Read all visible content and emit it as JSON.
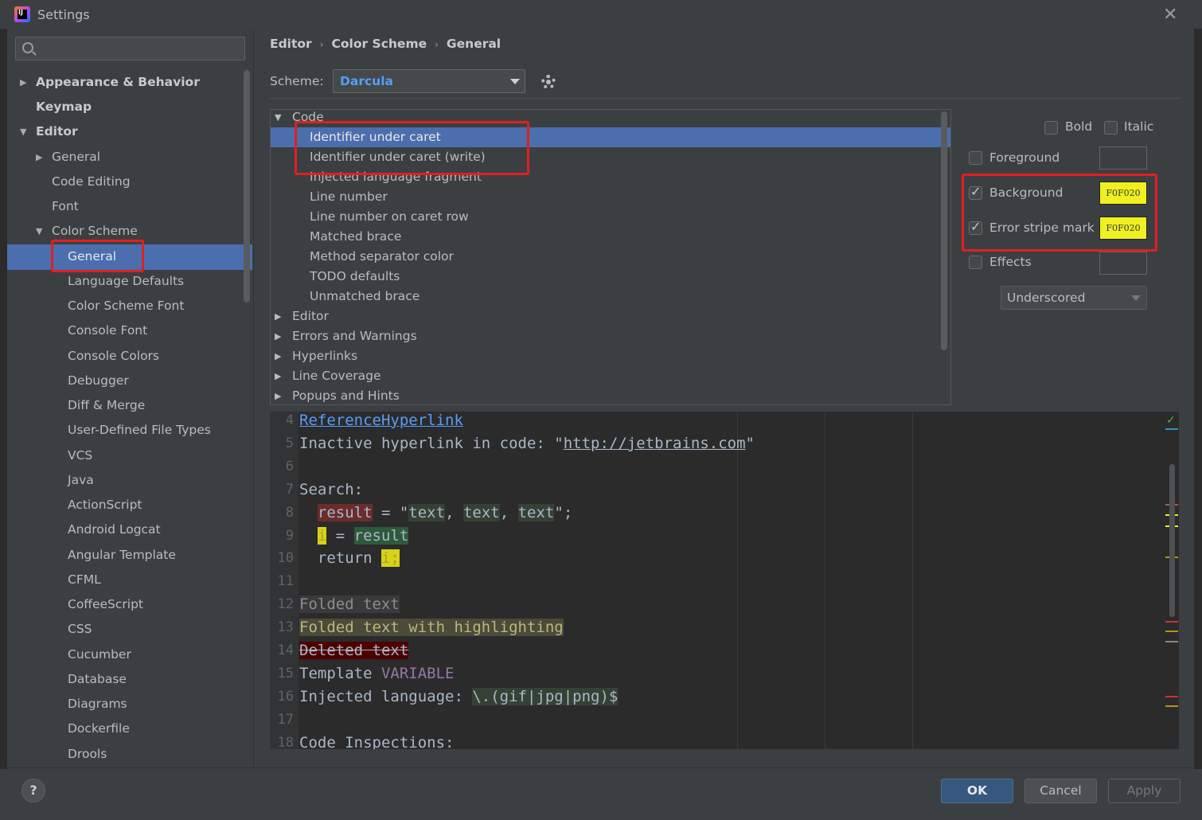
{
  "window": {
    "title": "Settings",
    "app_icon_text": "IJ"
  },
  "search": {
    "placeholder": ""
  },
  "tree": {
    "items": [
      {
        "label": "Appearance & Behavior"
      },
      {
        "label": "Keymap"
      },
      {
        "label": "Editor"
      },
      {
        "label": "General"
      },
      {
        "label": "Code Editing"
      },
      {
        "label": "Font"
      },
      {
        "label": "Color Scheme"
      },
      {
        "label": "General"
      },
      {
        "label": "Language Defaults"
      },
      {
        "label": "Color Scheme Font"
      },
      {
        "label": "Console Font"
      },
      {
        "label": "Console Colors"
      },
      {
        "label": "Debugger"
      },
      {
        "label": "Diff & Merge"
      },
      {
        "label": "User-Defined File Types"
      },
      {
        "label": "VCS"
      },
      {
        "label": "Java"
      },
      {
        "label": "ActionScript"
      },
      {
        "label": "Android Logcat"
      },
      {
        "label": "Angular Template"
      },
      {
        "label": "CFML"
      },
      {
        "label": "CoffeeScript"
      },
      {
        "label": "CSS"
      },
      {
        "label": "Cucumber"
      },
      {
        "label": "Database"
      },
      {
        "label": "Diagrams"
      },
      {
        "label": "Dockerfile"
      },
      {
        "label": "Drools"
      }
    ]
  },
  "breadcrumb": {
    "part1": "Editor",
    "part2": "Color Scheme",
    "part3": "General",
    "sep": "›"
  },
  "scheme": {
    "label": "Scheme:",
    "value": "Darcula"
  },
  "codelist": {
    "rows": [
      {
        "label": "Code"
      },
      {
        "label": "Identifier under caret"
      },
      {
        "label": "Identifier under caret (write)"
      },
      {
        "label": "Injected language fragment"
      },
      {
        "label": "Line number"
      },
      {
        "label": "Line number on caret row"
      },
      {
        "label": "Matched brace"
      },
      {
        "label": "Method separator color"
      },
      {
        "label": "TODO defaults"
      },
      {
        "label": "Unmatched brace"
      },
      {
        "label": "Editor"
      },
      {
        "label": "Errors and Warnings"
      },
      {
        "label": "Hyperlinks"
      },
      {
        "label": "Line Coverage"
      },
      {
        "label": "Popups and Hints"
      }
    ]
  },
  "props": {
    "bold": "Bold",
    "italic": "Italic",
    "foreground": "Foreground",
    "background": "Background",
    "background_color": "F0F020",
    "error_stripe": "Error stripe mark",
    "error_stripe_color": "F0F020",
    "effects": "Effects",
    "effects_type": "Underscored"
  },
  "editor": {
    "lines": [
      {
        "n": "4",
        "parts": [
          [
            "hl-link",
            "ReferenceHyperlink"
          ]
        ]
      },
      {
        "n": "5",
        "parts": [
          [
            "",
            "Inactive hyperlink in code: \""
          ],
          [
            "u",
            "http://jetbrains.com"
          ],
          [
            "",
            "\""
          ]
        ]
      },
      {
        "n": "6",
        "parts": []
      },
      {
        "n": "7",
        "parts": [
          [
            "",
            "Search:"
          ]
        ]
      },
      {
        "n": "8",
        "parts": [
          [
            "",
            "  "
          ],
          [
            "err-bg",
            "result"
          ],
          [
            "",
            " = \""
          ],
          [
            "grn-bg",
            "text"
          ],
          [
            "",
            ", "
          ],
          [
            "grn-bg",
            "text"
          ],
          [
            "",
            ", "
          ],
          [
            "grn-bg",
            "text"
          ],
          [
            "",
            "\";"
          ]
        ]
      },
      {
        "n": "9",
        "parts": [
          [
            "",
            "  "
          ],
          [
            "yel-bg",
            "i"
          ],
          [
            "",
            " = "
          ],
          [
            "grn2-bg",
            "result"
          ]
        ]
      },
      {
        "n": "10",
        "parts": [
          [
            "",
            "  return "
          ],
          [
            "yel-bg",
            "i;"
          ]
        ]
      },
      {
        "n": "11",
        "parts": []
      },
      {
        "n": "12",
        "parts": [
          [
            "fold",
            "Folded text"
          ]
        ]
      },
      {
        "n": "13",
        "parts": [
          [
            "fold2",
            "Folded text with highlighting"
          ]
        ]
      },
      {
        "n": "14",
        "parts": [
          [
            "del",
            "Deleted text"
          ]
        ]
      },
      {
        "n": "15",
        "parts": [
          [
            "",
            "Template "
          ],
          [
            "var",
            "VARIABLE"
          ]
        ]
      },
      {
        "n": "16",
        "parts": [
          [
            "",
            "Injected language: "
          ],
          [
            "inj",
            "\\.(gif|jpg|png)$"
          ]
        ]
      },
      {
        "n": "17",
        "parts": []
      },
      {
        "n": "18",
        "parts": [
          [
            "",
            "Code Inspections:"
          ]
        ]
      }
    ]
  },
  "buttons": {
    "help": "?",
    "ok": "OK",
    "cancel": "Cancel",
    "apply": "Apply"
  },
  "colors": {
    "accent": "#4b6eaf",
    "highlight_box": "#e0201f",
    "swatch": "#f0f020"
  }
}
